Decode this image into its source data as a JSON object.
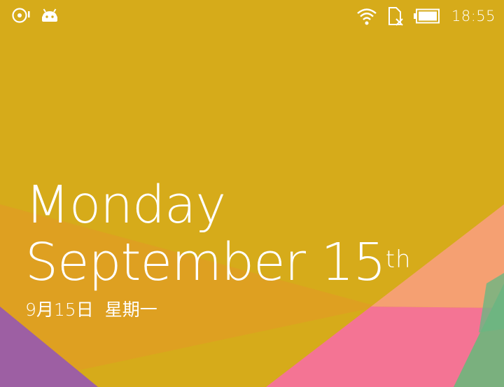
{
  "status_bar": {
    "time": "18:55",
    "left_icons": [
      "screen-record-icon",
      "android-icon"
    ],
    "right_icons": [
      "wifi-icon",
      "no-sim-icon",
      "battery-icon"
    ]
  },
  "lockscreen": {
    "day_name": "Monday",
    "date_text": "September 15",
    "date_suffix": "th",
    "chinese_date": "9月15日",
    "chinese_weekday": "星期一"
  },
  "colors": {
    "background": "#d6ab1a",
    "pink": "#f47494",
    "peach": "#f5a072",
    "green": "#7ab07e",
    "purple": "#9d5fa3",
    "orange": "#df9f22",
    "text": "#ffffff"
  }
}
